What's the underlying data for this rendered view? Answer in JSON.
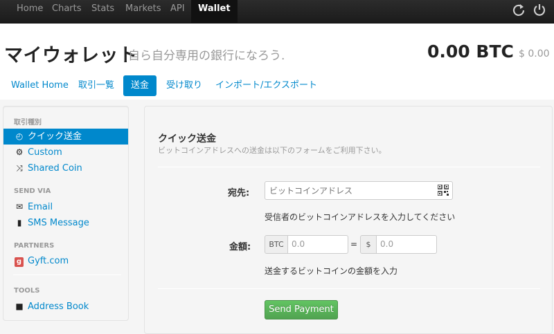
{
  "nav": {
    "items": [
      "Home",
      "Charts",
      "Stats",
      "Markets",
      "API",
      "Wallet"
    ],
    "active": "Wallet",
    "icons": [
      "refresh-icon",
      "power-icon"
    ]
  },
  "header": {
    "title": "マイウォレット",
    "subtitle": "自ら自分専用の銀行になろう.",
    "balance": "0.00 BTC",
    "fiat": "$ 0.00"
  },
  "tabs": {
    "items": [
      "Wallet Home",
      "取引一覧",
      "送金",
      "受け取り",
      "インポート/エクスポート"
    ],
    "active": "送金"
  },
  "sidebar": {
    "transaction_header": "取引種別",
    "quick_send": "クイック送金",
    "custom": "Custom",
    "shared_coin": "Shared Coin",
    "send_via_header": "SEND VIA",
    "email": "Email",
    "sms": "SMS Message",
    "partners_header": "PARTNERS",
    "gyft": "Gyft.com",
    "gyft_letter": "g",
    "tools_header": "TOOLS",
    "address_book": "Address Book"
  },
  "form": {
    "title": "クイック送金",
    "description": "ビットコインアドレスへの送金は以下のフォームをご利用下さい。",
    "to_label": "宛先:",
    "address_placeholder": "ビットコインアドレス",
    "address_help": "受信者のビットコインアドレスを入力してください",
    "amount_label": "金額:",
    "btc_addon": "BTC",
    "btc_value": "0.0",
    "equals": "=",
    "usd_addon": "$",
    "usd_value": "0.0",
    "amount_help": "送金するビットコインの金額を入力",
    "send_button": "Send Payment"
  },
  "colors": {
    "link": "#0088cc",
    "navbar": "#1b1b1b",
    "button_green": "#5bb75b"
  }
}
